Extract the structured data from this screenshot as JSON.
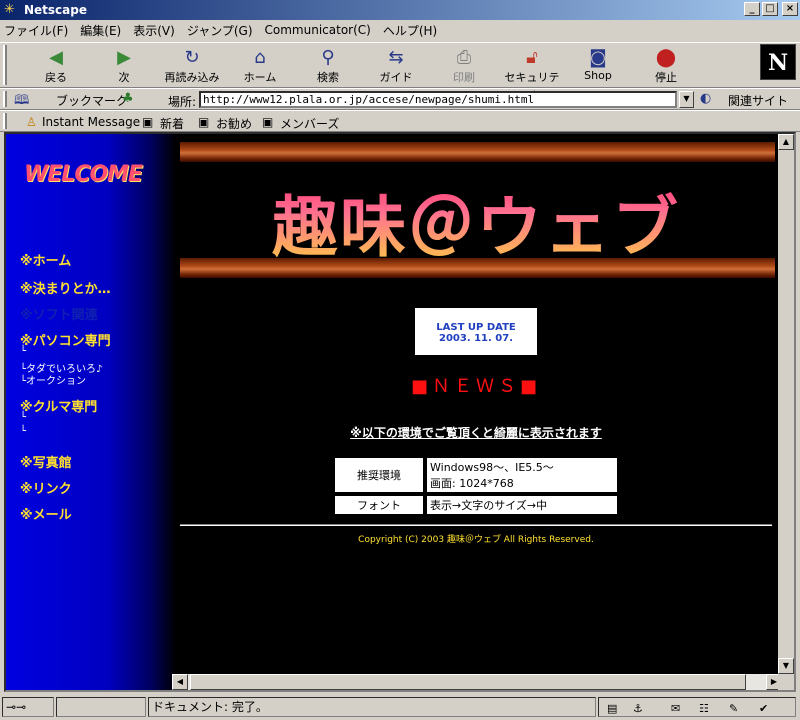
{
  "window": {
    "title": "Netscape"
  },
  "menu": [
    "ファイル(F)",
    "編集(E)",
    "表示(V)",
    "ジャンプ(G)",
    "Communicator(C)",
    "ヘルプ(H)"
  ],
  "toolbar": {
    "buttons": [
      {
        "label": "戻る",
        "icon": "back-arrow"
      },
      {
        "label": "次",
        "icon": "forward-arrow"
      },
      {
        "label": "再読み込み",
        "icon": "reload"
      },
      {
        "label": "ホーム",
        "icon": "home"
      },
      {
        "label": "検索",
        "icon": "search"
      },
      {
        "label": "ガイド",
        "icon": "guide"
      },
      {
        "label": "印刷",
        "icon": "print"
      },
      {
        "label": "セキュリティ",
        "icon": "lock"
      },
      {
        "label": "Shop",
        "icon": "shop"
      },
      {
        "label": "停止",
        "icon": "stop"
      }
    ]
  },
  "location": {
    "bookmarks_label": "ブックマーク",
    "label": "場所:",
    "url": "http://www12.plala.or.jp/accese/newpage/shumi.html",
    "related_label": "関連サイト"
  },
  "personal": [
    "Instant Message",
    "新着",
    "お勧め",
    "メンバーズ"
  ],
  "sidebar": {
    "welcome": "WELCOME",
    "items": [
      "※ホーム",
      "※決まりとか…",
      "※ソフト関連",
      "※パソコン専門",
      "※クルマ専門",
      "※写真館",
      "※リンク",
      "※メール"
    ],
    "pc_sub": [
      "└",
      "└タダでいろいろ♪",
      "└オークション"
    ],
    "car_sub": [
      "└",
      "└"
    ]
  },
  "main": {
    "title": "趣味＠ウェブ",
    "update_label": "LAST UP DATE",
    "update_date": "2003. 11. 07.",
    "news": "■ＮＥＷＳ■",
    "env_heading": "※以下の環境でご覧頂くと綺麗に表示されます",
    "env_rows": [
      {
        "key": "推奨環境",
        "value_line1": "Windows98〜、IE5.5〜",
        "value_line2": "画面: 1024*768"
      },
      {
        "key": "フォント",
        "value_line1": "表示→文字のサイズ→中",
        "value_line2": ""
      }
    ],
    "copyright": "Copyright (C) 2003 趣味＠ウェブ All Rights Reserved."
  },
  "status": {
    "text": "ドキュメント: 完了。"
  },
  "colors": {
    "sidebar_blue": "#0000e0",
    "nav_yellow": "#ffe030",
    "title_pink": "#ff4a8a",
    "news_red": "#ff1010"
  }
}
